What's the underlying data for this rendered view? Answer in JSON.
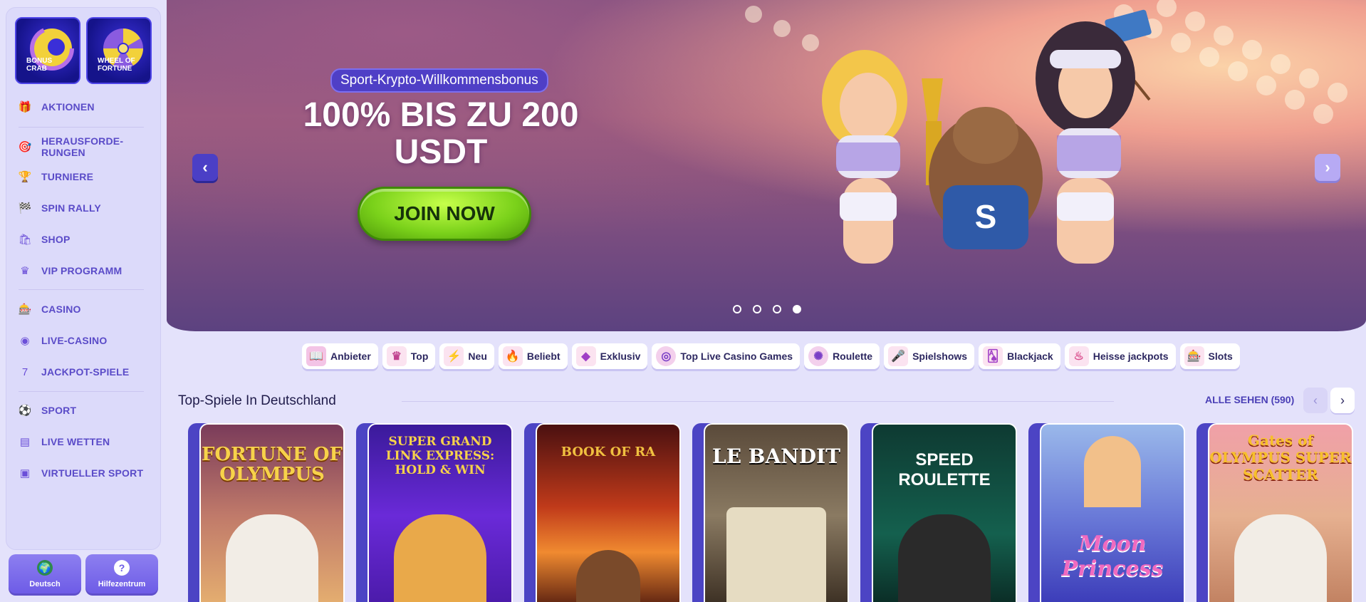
{
  "sidebar": {
    "promos": [
      {
        "label": "BONUS CRAB",
        "icon": "bonus-crab-icon"
      },
      {
        "label": "WHEEL OF FORTUNE",
        "icon": "wheel-of-fortune-icon"
      }
    ],
    "items": [
      {
        "label": "AKTIONEN",
        "icon": "gift-icon"
      },
      {
        "label": "HERAUSFORDE-\nRUNGEN",
        "icon": "challenge-icon"
      },
      {
        "label": "TURNIERE",
        "icon": "trophy-icon"
      },
      {
        "label": "SPIN RALLY",
        "icon": "flag-icon"
      },
      {
        "label": "SHOP",
        "icon": "shop-icon"
      },
      {
        "label": "VIP PROGRAMM",
        "icon": "crown-icon"
      },
      {
        "label": "CASINO",
        "icon": "casino-icon"
      },
      {
        "label": "LIVE-CASINO",
        "icon": "live-casino-icon"
      },
      {
        "label": "JACKPOT-SPIELE",
        "icon": "jackpot-icon"
      },
      {
        "label": "SPORT",
        "icon": "sport-ball-icon"
      },
      {
        "label": "LIVE WETTEN",
        "icon": "live-bet-icon"
      },
      {
        "label": "VIRTUELLER SPORT",
        "icon": "virtual-sport-icon"
      }
    ],
    "language_label": "Deutsch",
    "help_label": "Hilfezentrum"
  },
  "hero": {
    "badge": "Sport-Krypto-Willkommensbonus",
    "title": "100% BIS ZU 200 USDT",
    "cta": "JOIN NOW",
    "slides_total": 4,
    "slide_active": 4
  },
  "categories": [
    {
      "label": "Anbieter",
      "icon": "book-icon"
    },
    {
      "label": "Top",
      "icon": "crown-icon"
    },
    {
      "label": "Neu",
      "icon": "lightning-icon"
    },
    {
      "label": "Beliebt",
      "icon": "fire-icon"
    },
    {
      "label": "Exklusiv",
      "icon": "diamond-icon"
    },
    {
      "label": "Top Live Casino Games",
      "icon": "chip-icon"
    },
    {
      "label": "Roulette",
      "icon": "roulette-icon"
    },
    {
      "label": "Spielshows",
      "icon": "microphone-icon"
    },
    {
      "label": "Blackjack",
      "icon": "cards-icon"
    },
    {
      "label": "Heisse jackpots",
      "icon": "hot-jackpot-icon"
    },
    {
      "label": "Slots",
      "icon": "slots-icon"
    }
  ],
  "section": {
    "title": "Top-Spiele In Deutschland",
    "see_all": "ALLE SEHEN (590)"
  },
  "games": [
    {
      "title": "FORTUNE OF OLYMPUS"
    },
    {
      "title": "SUPER GRAND LINK EXPRESS: HOLD & WIN"
    },
    {
      "title": "BOOK OF RA"
    },
    {
      "title": "LE BANDIT"
    },
    {
      "title": "SPEED ROULETTE"
    },
    {
      "title": "Moon Princess"
    },
    {
      "title": "Gates of OLYMPUS SUPER SCATTER"
    }
  ]
}
